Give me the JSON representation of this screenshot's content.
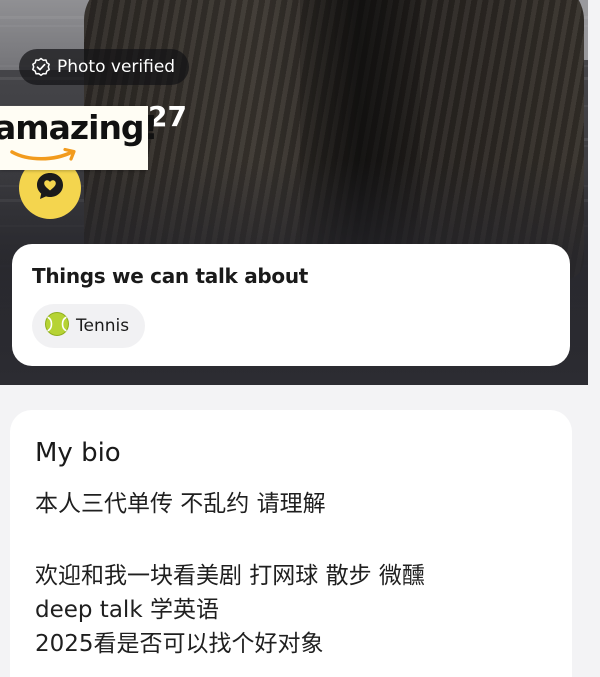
{
  "profile": {
    "verified_label": "Photo verified",
    "sticker_text": "amazing!",
    "age": "27"
  },
  "icons": {
    "verified": "check-badge-icon",
    "interest_button": "heart-speech-bubble-icon",
    "tennis": "tennis-ball-icon"
  },
  "colors": {
    "accent_yellow": "#f4d54e",
    "tennis_ball": "#b6d334",
    "smile_orange": "#f29b1d"
  },
  "talk_card": {
    "title": "Things we can talk about",
    "topics": [
      {
        "label": "Tennis",
        "icon": "tennis-ball-icon"
      }
    ]
  },
  "bio": {
    "title": "My bio",
    "lines": [
      "本人三代单传 不乱约 请理解",
      "欢迎和我一块看美剧 打网球 散步 微醺",
      "deep talk 学英语",
      "2025看是否可以找个好对象"
    ]
  }
}
